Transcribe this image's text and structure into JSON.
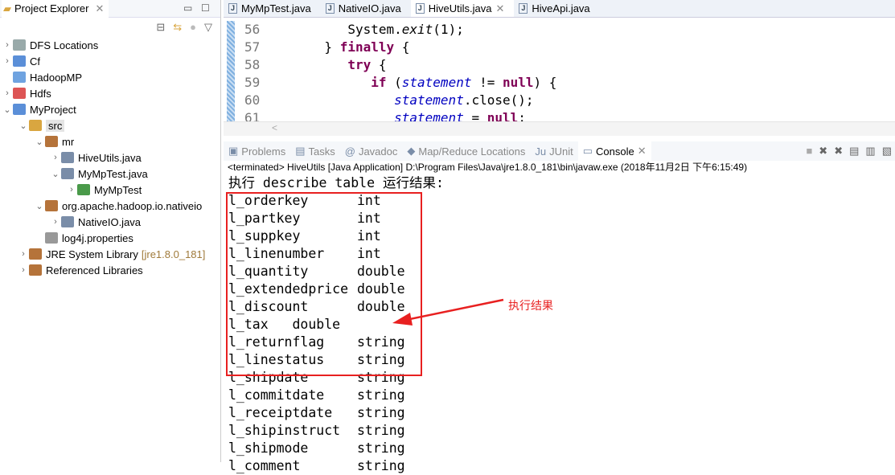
{
  "explorer": {
    "title": "Project Explorer",
    "items": [
      {
        "label": "DFS Locations",
        "depth": 0,
        "arrow": "right"
      },
      {
        "label": "Cf",
        "depth": 0,
        "arrow": "right"
      },
      {
        "label": "HadoopMP",
        "depth": 0,
        "arrow": ""
      },
      {
        "label": "Hdfs",
        "depth": 0,
        "arrow": "right"
      },
      {
        "label": "MyProject",
        "depth": 0,
        "arrow": "down"
      },
      {
        "label": "src",
        "depth": 1,
        "arrow": "down"
      },
      {
        "label": "mr",
        "depth": 2,
        "arrow": "down"
      },
      {
        "label": "HiveUtils.java",
        "depth": 3,
        "arrow": "right"
      },
      {
        "label": "MyMpTest.java",
        "depth": 3,
        "arrow": "down"
      },
      {
        "label": "MyMpTest",
        "depth": 4,
        "arrow": "right"
      },
      {
        "label": "org.apache.hadoop.io.nativeio",
        "depth": 2,
        "arrow": "down"
      },
      {
        "label": "NativeIO.java",
        "depth": 3,
        "arrow": "right"
      },
      {
        "label": "log4j.properties",
        "depth": 2,
        "arrow": ""
      },
      {
        "label": "JRE System Library",
        "suffix": "[jre1.8.0_181]",
        "depth": 1,
        "arrow": "right"
      },
      {
        "label": "Referenced Libraries",
        "depth": 1,
        "arrow": "right"
      }
    ]
  },
  "editor": {
    "tabs": [
      "MyMpTest.java",
      "NativeIO.java",
      "HiveUtils.java",
      "HiveApi.java"
    ],
    "active_tab": "HiveUtils.java",
    "line_numbers": [
      "56",
      "57",
      "58",
      "59",
      "60",
      "61"
    ]
  },
  "console": {
    "tabs": [
      "Problems",
      "Tasks",
      "Javadoc",
      "Map/Reduce Locations",
      "JUnit",
      "Console"
    ],
    "active_tab": "Console",
    "status": "<terminated> HiveUtils [Java Application] D:\\Program Files\\Java\\jre1.8.0_181\\bin\\javaw.exe (2018年11月2日 下午6:15:49)",
    "header": "执行 describe table 运行结果:",
    "rows": [
      [
        "l_orderkey",
        "int"
      ],
      [
        "l_partkey",
        "int"
      ],
      [
        "l_suppkey",
        "int"
      ],
      [
        "l_linenumber",
        "int"
      ],
      [
        "l_quantity",
        "double"
      ],
      [
        "l_extendedprice",
        "double"
      ],
      [
        "l_discount",
        "double"
      ],
      [
        "l_tax   double",
        ""
      ],
      [
        "l_returnflag",
        "string"
      ],
      [
        "l_linestatus",
        "string"
      ],
      [
        "l_shipdate",
        "string"
      ],
      [
        "l_commitdate",
        "string"
      ],
      [
        "l_receiptdate",
        "string"
      ],
      [
        "l_shipinstruct",
        "string"
      ],
      [
        "l_shipmode",
        "string"
      ],
      [
        "l_comment",
        "string"
      ]
    ]
  },
  "annotation": {
    "label": "执行结果",
    "color": "#e82020"
  }
}
